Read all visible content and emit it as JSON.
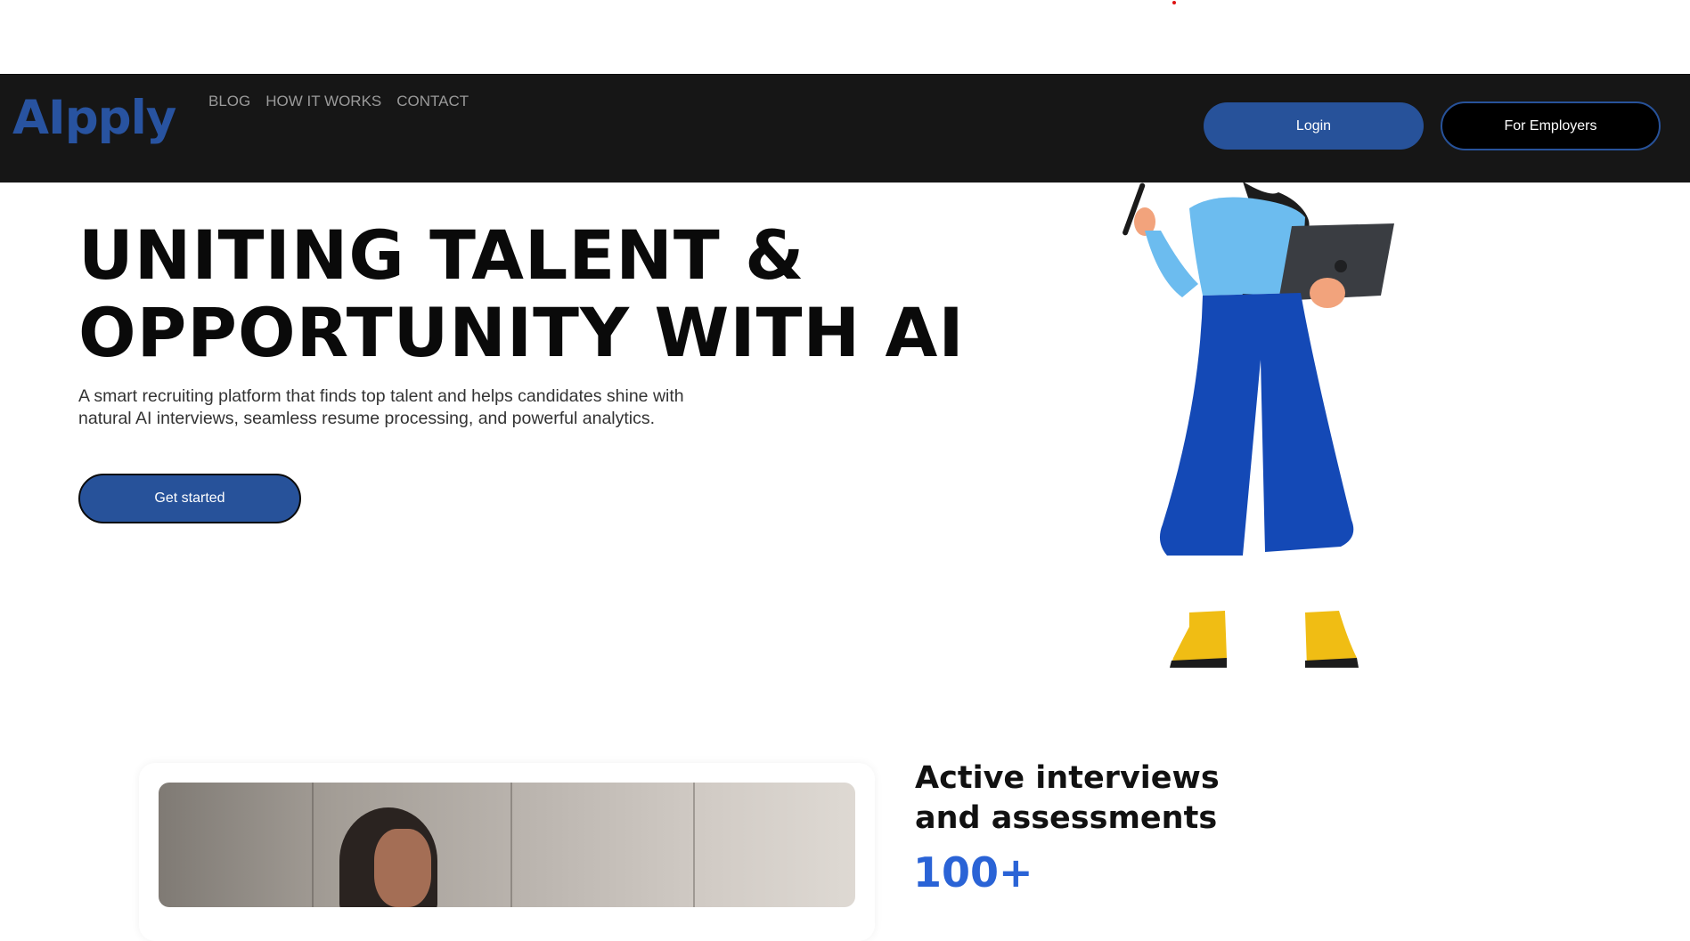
{
  "brand": {
    "logo_text": "AIpply",
    "accent_color": "#27529a"
  },
  "nav": {
    "links": [
      "BLOG",
      "HOW IT WORKS",
      "CONTACT"
    ],
    "login_label": "Login",
    "employers_label": "For Employers"
  },
  "hero": {
    "title_line1": "UNITING TALENT &",
    "title_line2": "OPPORTUNITY WITH AI",
    "description": "A smart recruiting platform that finds top talent and helps candidates shine with natural AI interviews, seamless resume processing, and powerful analytics.",
    "cta_label": "Get started",
    "illustration": "woman-with-laptop-illustration"
  },
  "stats": {
    "title_line1": "Active interviews",
    "title_line2": "and assessments",
    "value": "100+",
    "photo": "man-working-photo"
  }
}
